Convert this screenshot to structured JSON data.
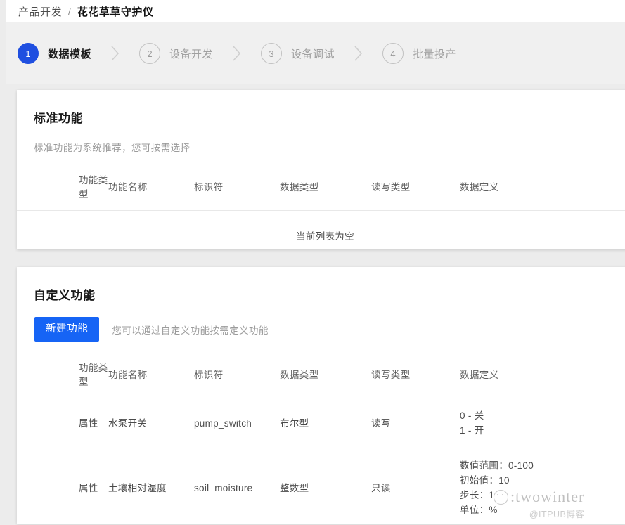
{
  "breadcrumb": {
    "parent": "产品开发",
    "separator": "/",
    "current": "花花草草守护仪"
  },
  "stepper": {
    "active_color": "#1f4fe0",
    "inactive_color": "#a0a0a0",
    "steps": [
      {
        "number": "1",
        "label": "数据模板",
        "state": "active"
      },
      {
        "number": "2",
        "label": "设备开发",
        "state": "inactive"
      },
      {
        "number": "3",
        "label": "设备调试",
        "state": "inactive"
      },
      {
        "number": "4",
        "label": "批量投产",
        "state": "inactive"
      }
    ]
  },
  "standard_section": {
    "title": "标准功能",
    "description": "标准功能为系统推荐，您可按需选择",
    "columns": [
      "功能类型",
      "功能名称",
      "标识符",
      "数据类型",
      "读写类型",
      "数据定义"
    ],
    "empty_text": "当前列表为空",
    "rows": []
  },
  "custom_section": {
    "title": "自定义功能",
    "create_button": "新建功能",
    "create_button_color": "#1664f5",
    "hint": "您可以通过自定义功能按需定义功能",
    "columns": [
      "功能类型",
      "功能名称",
      "标识符",
      "数据类型",
      "读写类型",
      "数据定义"
    ],
    "rows": [
      {
        "type": "属性",
        "name": "水泵开关",
        "identifier": "pump_switch",
        "data_type": "布尔型",
        "access": "读写",
        "definition": [
          "0 - 关",
          "1 - 开"
        ]
      },
      {
        "type": "属性",
        "name": "土壤相对湿度",
        "identifier": "soil_moisture",
        "data_type": "整数型",
        "access": "只读",
        "definition": [
          "数值范围：0-100",
          "初始值：10",
          "步长：1",
          "单位：%"
        ]
      }
    ]
  },
  "watermark": {
    "text": ":twowinter",
    "subtext": "@ITPUB博客"
  }
}
